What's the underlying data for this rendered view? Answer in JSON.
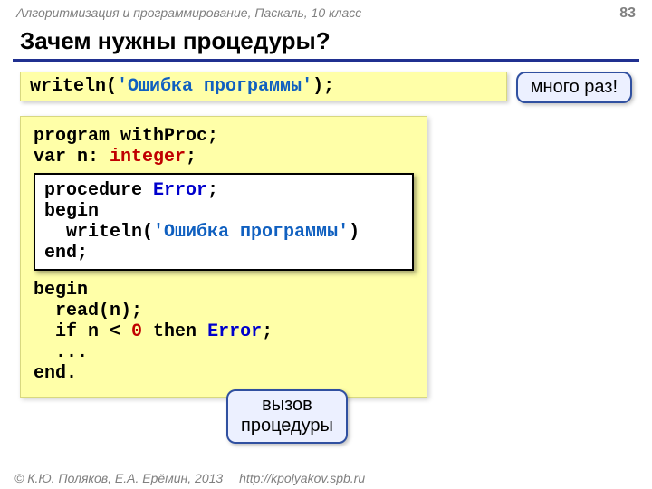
{
  "header": {
    "course": "Алгоритмизация и программирование, Паскаль, 10 класс",
    "page": "83"
  },
  "title": "Зачем нужны процедуры?",
  "snippet": {
    "writeln": "writeln",
    "open": "(",
    "str": "'Ошибка программы'",
    "close": ");"
  },
  "callout_many": "много раз!",
  "prog": {
    "l1a": "program",
    "l1b": " withProc;",
    "l2a": "var",
    "l2b": " n: ",
    "l2c": "integer",
    "l2d": ";"
  },
  "proc": {
    "l1a": "procedure",
    "l1b": " Error",
    "l1c": ";",
    "l2": "begin",
    "l3a": "  writeln(",
    "l3b": "'Ошибка программы'",
    "l3c": ")",
    "l4": "end",
    "l4b": ";"
  },
  "main": {
    "l1": "begin",
    "l2": "  read(n);",
    "l3a": "  if",
    "l3b": " n < ",
    "l3c": "0",
    "l3d": " then ",
    "l3e": "Error",
    "l3f": ";",
    "l4": "  ...",
    "l5": "end",
    "l5b": "."
  },
  "callout_call_l1": "вызов",
  "callout_call_l2": "процедуры",
  "footer": {
    "copyright": "© К.Ю. Поляков, Е.А. Ерёмин, 2013",
    "url": "http://kpolyakov.spb.ru"
  }
}
